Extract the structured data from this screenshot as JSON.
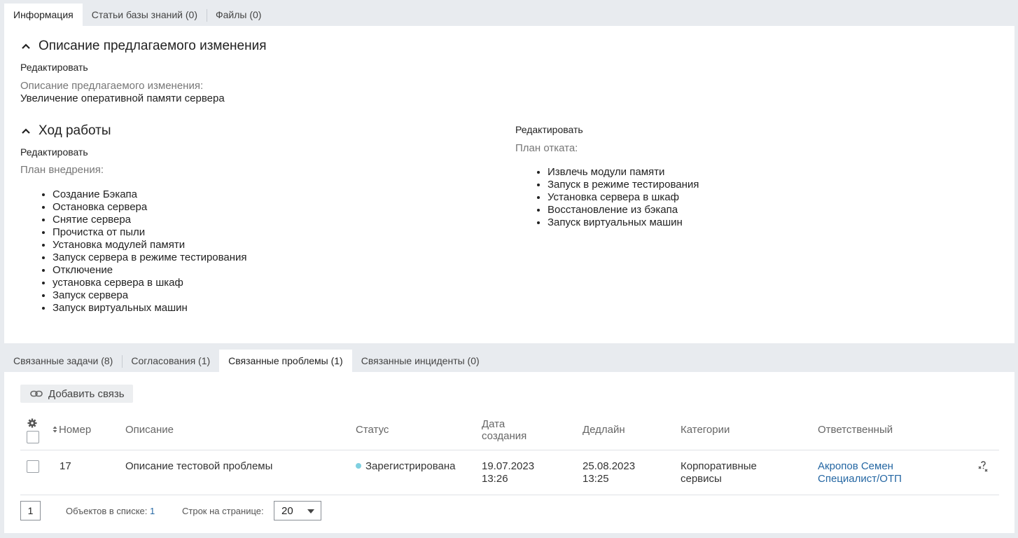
{
  "top_tabs": [
    {
      "label": "Информация",
      "active": true
    },
    {
      "label": "Статьи базы знаний (0)",
      "active": false
    },
    {
      "label": "Файлы (0)",
      "active": false
    }
  ],
  "description_section": {
    "title": "Описание предлагаемого изменения",
    "edit_label": "Редактировать",
    "field_label": "Описание предлагаемого изменения:",
    "field_value": "Увеличение оперативной памяти сервера"
  },
  "progress_section": {
    "title": "Ход работы",
    "deploy": {
      "edit_label": "Редактировать",
      "label": "План внедрения:",
      "items": [
        "Создание Бэкапа",
        "Остановка сервера",
        "Снятие сервера",
        "Прочистка от пыли",
        "Установка модулей памяти",
        "Запуск сервера в режиме тестирования",
        "Отключение",
        "установка сервера в шкаф",
        "Запуск сервера",
        "Запуск виртуальных машин"
      ]
    },
    "rollback": {
      "edit_label": "Редактировать",
      "label": "План отката:",
      "items": [
        "Извлечь модули памяти",
        "Запуск в режиме тестирования",
        "Установка сервера в шкаф",
        "Восстановление из бэкапа",
        "Запуск виртуальных машин"
      ]
    }
  },
  "bottom_tabs": [
    {
      "label": "Связанные задачи (8)",
      "active": false
    },
    {
      "label": "Согласования (1)",
      "active": false
    },
    {
      "label": "Связанные проблемы (1)",
      "active": true
    },
    {
      "label": "Связанные инциденты (0)",
      "active": false
    }
  ],
  "add_link_button": "Добавить связь",
  "table": {
    "columns": {
      "number": "Номер",
      "description": "Описание",
      "status": "Статус",
      "created_line1": "Дата",
      "created_line2": "создания",
      "deadline": "Дедлайн",
      "category": "Категории",
      "responsible": "Ответственный"
    },
    "rows": [
      {
        "number": "17",
        "description": "Описание тестовой проблемы",
        "status": "Зарегистрирована",
        "status_color": "#7fd0e0",
        "created_date": "19.07.2023",
        "created_time": "13:26",
        "deadline_date": "25.08.2023",
        "deadline_time": "13:25",
        "category_line1": "Корпоративные",
        "category_line2": "сервисы",
        "responsible_name": "Акропов Семен",
        "responsible_role": "Специалист/ОТП"
      }
    ]
  },
  "footer": {
    "page": "1",
    "objects_label": "Объектов в списке:",
    "objects_count": "1",
    "rows_label": "Строк на странице:",
    "rows_per_page": "20"
  },
  "colors": {
    "link": "#2567a3",
    "panel": "#ffffff",
    "background": "#e8ebef"
  }
}
